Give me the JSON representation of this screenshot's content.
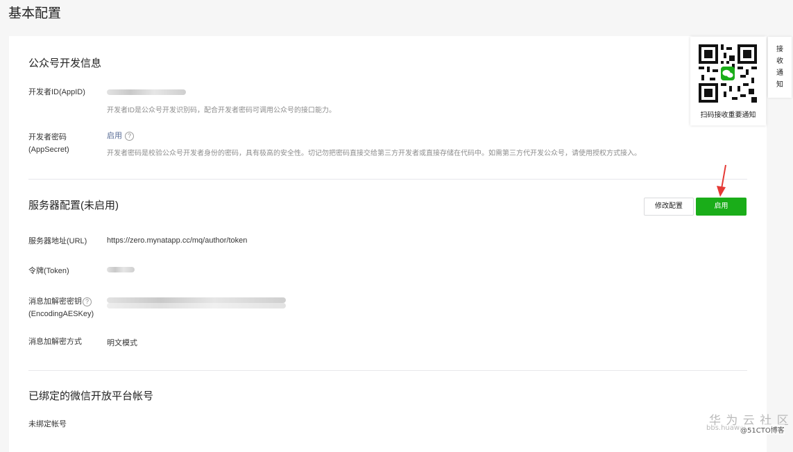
{
  "page": {
    "title": "基本配置"
  },
  "dev_info": {
    "title": "公众号开发信息",
    "appid_label": "开发者ID(AppID)",
    "appid_hint": "开发者ID是公众号开发识别码，配合开发者密码可调用公众号的接口能力。",
    "secret_label_line1": "开发者密码",
    "secret_label_line2": "(AppSecret)",
    "secret_status": "启用",
    "secret_hint": "开发者密码是校验公众号开发者身份的密码，具有极高的安全性。切记勿把密码直接交给第三方开发者或直接存储在代码中。如需第三方代开发公众号，请使用授权方式接入。"
  },
  "server": {
    "title": "服务器配置(未启用)",
    "modify_label": "修改配置",
    "enable_label": "启用",
    "url_label": "服务器地址(URL)",
    "url_value": "https://zero.mynatapp.cc/mq/author/token",
    "token_label": "令牌(Token)",
    "aes_label_line1": "消息加解密密钥",
    "aes_label_line2": "(EncodingAESKey)",
    "mode_label": "消息加解密方式",
    "mode_value": "明文模式"
  },
  "bound": {
    "title": "已绑定的微信开放平台帐号",
    "none_label": "未绑定帐号"
  },
  "qr": {
    "caption": "扫码接收重要通知"
  },
  "side_tab": {
    "chars": [
      "接",
      "收",
      "通",
      "知"
    ]
  },
  "watermark": {
    "line1": "华 为 云 社 区",
    "line2": "bbs.huawei",
    "line3": "@51CTO博客"
  },
  "colors": {
    "accent": "#1aad19",
    "arrow": "#e53935"
  }
}
